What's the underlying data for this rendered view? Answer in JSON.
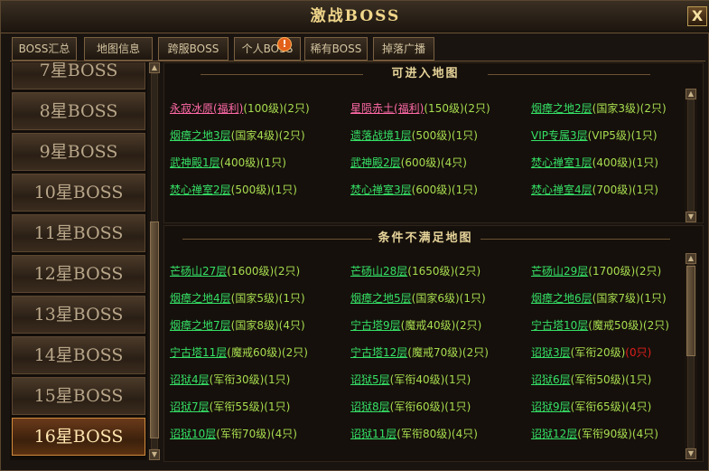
{
  "window": {
    "title": "激战BOSS",
    "close_label": "X"
  },
  "tabs": [
    {
      "label": "BOSS汇总",
      "active": true
    },
    {
      "label": "地图信息",
      "active": false
    },
    {
      "label": "跨服BOSS",
      "active": false
    },
    {
      "label": "个人BOSS",
      "active": false
    },
    {
      "label": "稀有BOSS",
      "active": false
    },
    {
      "label": "掉落广播",
      "active": false
    }
  ],
  "tab_badge": "!",
  "boss_levels": [
    "7星BOSS",
    "8星BOSS",
    "9星BOSS",
    "10星BOSS",
    "11星BOSS",
    "12星BOSS",
    "13星BOSS",
    "14星BOSS",
    "15星BOSS",
    "16星BOSS"
  ],
  "selected_level": "16星BOSS",
  "accessible": {
    "header": "可进入地图",
    "maps": [
      {
        "name": "永寂冰原(福利)",
        "info": "(100级)(2只)",
        "color": "pink"
      },
      {
        "name": "星陨赤土(福利)",
        "info": "(150级)(2只)",
        "color": "pink"
      },
      {
        "name": "烟瘴之地2层",
        "info": "(国家3级)(2只)",
        "color": "green"
      },
      {
        "name": "烟瘴之地3层",
        "info": "(国家4级)(2只)",
        "color": "green"
      },
      {
        "name": "遗落战境1层",
        "info": "(500级)(1只)",
        "color": "green"
      },
      {
        "name": "VIP专属3层",
        "info": "(VIP5级)(1只)",
        "color": "green"
      },
      {
        "name": "武神殿1层",
        "info": "(400级)(1只)",
        "color": "green"
      },
      {
        "name": "武神殿2层",
        "info": "(600级)(4只)",
        "color": "green"
      },
      {
        "name": "焚心禅室1层",
        "info": "(400级)(1只)",
        "color": "green"
      },
      {
        "name": "焚心禅室2层",
        "info": "(500级)(1只)",
        "color": "green"
      },
      {
        "name": "焚心禅室3层",
        "info": "(600级)(1只)",
        "color": "green"
      },
      {
        "name": "焚心禅室4层",
        "info": "(700级)(1只)",
        "color": "green"
      }
    ]
  },
  "locked": {
    "header": "条件不满足地图",
    "maps": [
      {
        "name": "芒砀山27层",
        "info": "(1600级)(2只)"
      },
      {
        "name": "芒砀山28层",
        "info": "(1650级)(2只)"
      },
      {
        "name": "芒砀山29层",
        "info": "(1700级)(2只)"
      },
      {
        "name": "烟瘴之地4层",
        "info": "(国家5级)(1只)"
      },
      {
        "name": "烟瘴之地5层",
        "info": "(国家6级)(1只)"
      },
      {
        "name": "烟瘴之地6层",
        "info": "(国家7级)(1只)"
      },
      {
        "name": "烟瘴之地7层",
        "info": "(国家8级)(4只)"
      },
      {
        "name": "宁古塔9层",
        "info": "(魔戒40级)(2只)"
      },
      {
        "name": "宁古塔10层",
        "info": "(魔戒50级)(2只)"
      },
      {
        "name": "宁古塔11层",
        "info": "(魔戒60级)(2只)"
      },
      {
        "name": "宁古塔12层",
        "info": "(魔戒70级)(2只)"
      },
      {
        "name": "诏狱3层",
        "info": "(军衔20级)",
        "extra": "(0只)"
      },
      {
        "name": "诏狱4层",
        "info": "(军衔30级)(1只)"
      },
      {
        "name": "诏狱5层",
        "info": "(军衔40级)(1只)"
      },
      {
        "name": "诏狱6层",
        "info": "(军衔50级)(1只)"
      },
      {
        "name": "诏狱7层",
        "info": "(军衔55级)(1只)"
      },
      {
        "name": "诏狱8层",
        "info": "(军衔60级)(1只)"
      },
      {
        "name": "诏狱9层",
        "info": "(军衔65级)(4只)"
      },
      {
        "name": "诏狱10层",
        "info": "(军衔70级)(4只)"
      },
      {
        "name": "诏狱11层",
        "info": "(军衔80级)(4只)"
      },
      {
        "name": "诏狱12层",
        "info": "(军衔90级)(4只)"
      }
    ]
  },
  "colors": {
    "accent": "#f0d68a",
    "green_link": "#35e066",
    "pink_link": "#ff6aa8",
    "info": "#a8dd4f",
    "warning": "#e01e1e"
  },
  "icons": [
    "close-icon",
    "warning-icon",
    "scroll-up-icon",
    "scroll-down-icon"
  ]
}
